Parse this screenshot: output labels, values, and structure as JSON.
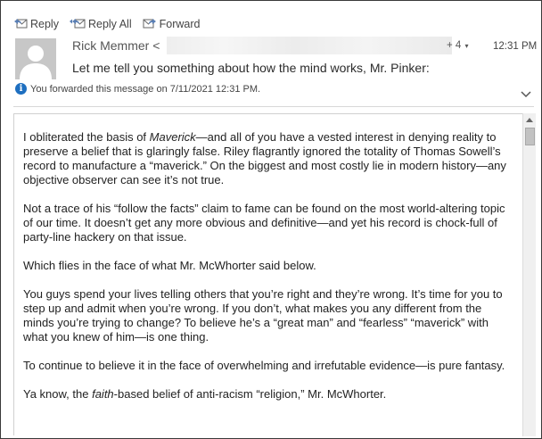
{
  "toolbar": {
    "reply_label": "Reply",
    "reply_all_label": "Reply All",
    "forward_label": "Forward"
  },
  "header": {
    "sender_name": "Rick Memmer <",
    "recipients_more": "+ 4",
    "time": "12:31 PM",
    "subject": "Let me tell you something about how the mind works, Mr. Pinker:",
    "forward_notice": "You forwarded this message on 7/11/2021 12:31 PM."
  },
  "body": {
    "p1_before": "I obliterated the basis of ",
    "p1_italic": "Maverick",
    "p1_after": "—and all of you have a vested interest in denying reality to preserve a belief that is glaringly false. Riley flagrantly ignored the totality of Thomas Sowell’s record to manufacture a “maverick.” On the biggest and most costly lie in modern history—any objective observer can see it’s not true.",
    "p2": "Not a trace of his “follow the facts” claim to fame can be found on the most world-altering topic of our time. It doesn’t get any more obvious and definitive—and yet his record is chock-full of party-line hackery on that issue.",
    "p3": "Which flies in the face of what Mr. McWhorter said below.",
    "p4": "You guys spend your lives telling others that you’re right and they’re wrong. It’s time for you to step up and admit when you’re wrong. If you don’t, what makes you any different from the minds you’re trying to change? To believe he’s a “great man” and “fearless” “maverick” with what you knew of him—is one thing.",
    "p5": "To continue to believe it in the face of overwhelming and irrefutable evidence—is pure fantasy.",
    "p6_before": "Ya know, the ",
    "p6_italic": "faith",
    "p6_after": "-based belief of anti-racism “religion,” Mr. McWhorter."
  },
  "icons": {
    "reply": "reply-icon",
    "reply_all": "reply-all-icon",
    "forward": "forward-icon",
    "info": "info-icon",
    "expand": "chevron-down-icon",
    "avatar": "avatar-placeholder"
  },
  "colors": {
    "info_blue": "#1e6fc0",
    "avatar_gray": "#c7c7c7"
  }
}
